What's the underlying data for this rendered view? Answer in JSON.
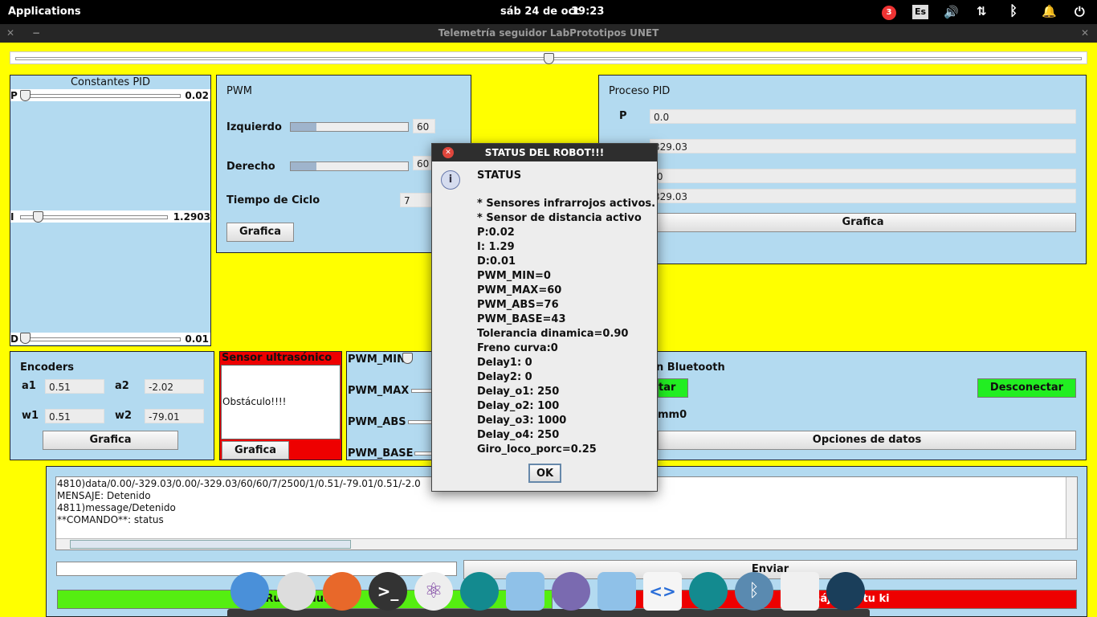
{
  "topbar": {
    "apps_label": "Applications",
    "date": "sáb 24 de oct",
    "time": "19:23",
    "notif_count": "3",
    "lang": "Es"
  },
  "window": {
    "title": "Telemetría seguidor LabPrototipos UNET"
  },
  "pid_constants": {
    "title": "Constantes PID",
    "p_label": "P",
    "p_value": "0.02",
    "i_label": "I",
    "i_value": "1.2903",
    "d_label": "D",
    "d_value": "0.01"
  },
  "pwm": {
    "title": "PWM",
    "left_label": "Izquierdo",
    "left_value": "60",
    "right_label": "Derecho",
    "right_value": "60",
    "cycle_label": "Tiempo de Ciclo",
    "cycle_value": "7",
    "graph_button": "Grafica",
    "left_fill": 0.22,
    "right_fill": 0.22
  },
  "pid_process": {
    "title": "Proceso PID",
    "p_label": "P",
    "v1": "0.0",
    "v2": "329.03",
    "v3": ".0",
    "v4": "329.03",
    "graph_button": "Grafica"
  },
  "encoders": {
    "title": "Encoders",
    "a1_label": "a1",
    "a1": "0.51",
    "a2_label": "a2",
    "a2": "-2.02",
    "w1_label": "w1",
    "w1": "0.51",
    "w2_label": "w2",
    "w2": "-79.01",
    "graph_button": "Grafica"
  },
  "ultrasonic": {
    "title": "Sensor ultrasónico",
    "text": "Obstáculo!!!!",
    "graph_button": "Grafica"
  },
  "pwm_limits": {
    "min_label": "PWM_MIN",
    "max_label": "PWM_MAX",
    "abs_label": "PWM_ABS",
    "base_label": "PWM_BASE"
  },
  "bluetooth": {
    "title": "n Bluetooth",
    "connect_label": "tar",
    "disconnect_label": "Desconectar",
    "port": "mm0",
    "options_button": "Opciones de datos"
  },
  "console": {
    "lines": [
      "4810)data/0.00/-329.03/0.00/-329.03/60/60/7/2500/1/0.51/-79.01/0.51/-2.0",
      "MENSAJE:  Detenido",
      "4811)message/Detenido",
      "**COMANDO**: status"
    ],
    "send_button": "Enviar",
    "run_label": "Ru        ues    uuu !!",
    "stop_label": "Bájale a tu ki"
  },
  "dialog": {
    "title": "STATUS DEL ROBOT!!!",
    "heading": "STATUS",
    "lines": [
      "* Sensores infrarrojos activos.",
      "* Sensor de distancia activo",
      "P:0.02",
      "I: 1.29",
      "D:0.01",
      "PWM_MIN=0",
      "PWM_MAX=60",
      "PWM_ABS=76",
      "PWM_BASE=43",
      "Tolerancia dinamica=0.90",
      "Freno curva:0",
      "Delay1: 0",
      "Delay2: 0",
      "Delay_o1: 250",
      "Delay_o2: 100",
      "Delay_o3: 1000",
      "Delay_o4: 250",
      "Giro_loco_porc=0.25"
    ],
    "ok_button": "OK"
  },
  "dock": {
    "icons": [
      "multitasking-icon",
      "switch-icon",
      "firefox-icon",
      "terminal-icon",
      "atom-icon",
      "arduino-icon",
      "cube-icon",
      "files-icon",
      "cube-icon",
      "code-icon",
      "arduino-icon",
      "bluetooth-icon",
      "java-icon",
      "image-icon"
    ]
  },
  "colors": {
    "background": "#ffff00",
    "panel": "#b3daf0",
    "green": "#33ee11",
    "red": "#ee0000"
  }
}
